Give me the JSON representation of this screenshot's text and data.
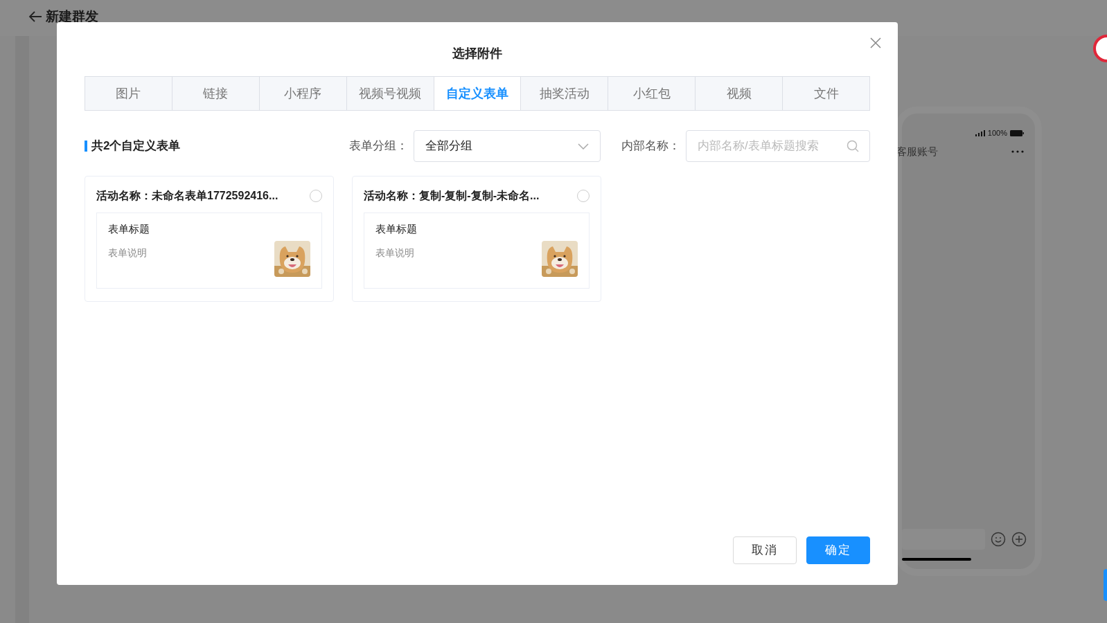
{
  "page": {
    "back_title": "新建群发"
  },
  "phone_preview": {
    "battery_text": "100%",
    "chat_title": "客服账号"
  },
  "dialog": {
    "title": "选择附件",
    "tabs": [
      {
        "label": "图片",
        "selected": false
      },
      {
        "label": "链接",
        "selected": false
      },
      {
        "label": "小程序",
        "selected": false
      },
      {
        "label": "视频号视频",
        "selected": false
      },
      {
        "label": "自定义表单",
        "selected": true
      },
      {
        "label": "抽奖活动",
        "selected": false
      },
      {
        "label": "小红包",
        "selected": false
      },
      {
        "label": "视频",
        "selected": false
      },
      {
        "label": "文件",
        "selected": false
      }
    ],
    "summary": "共2个自定义表单",
    "group_filter": {
      "label": "表单分组：",
      "value": "全部分组"
    },
    "name_filter": {
      "label": "内部名称：",
      "placeholder": "内部名称/表单标题搜索"
    },
    "forms": [
      {
        "name": "活动名称：未命名表单1772592416...",
        "selected": false,
        "title": "表单标题",
        "description": "表单说明"
      },
      {
        "name": "活动名称：复制-复制-复制-未命名...",
        "selected": false,
        "title": "表单标题",
        "description": "表单说明"
      }
    ],
    "buttons": [
      {
        "label": "取消",
        "kind": "secondary"
      },
      {
        "label": "确定",
        "kind": "primary"
      }
    ]
  }
}
